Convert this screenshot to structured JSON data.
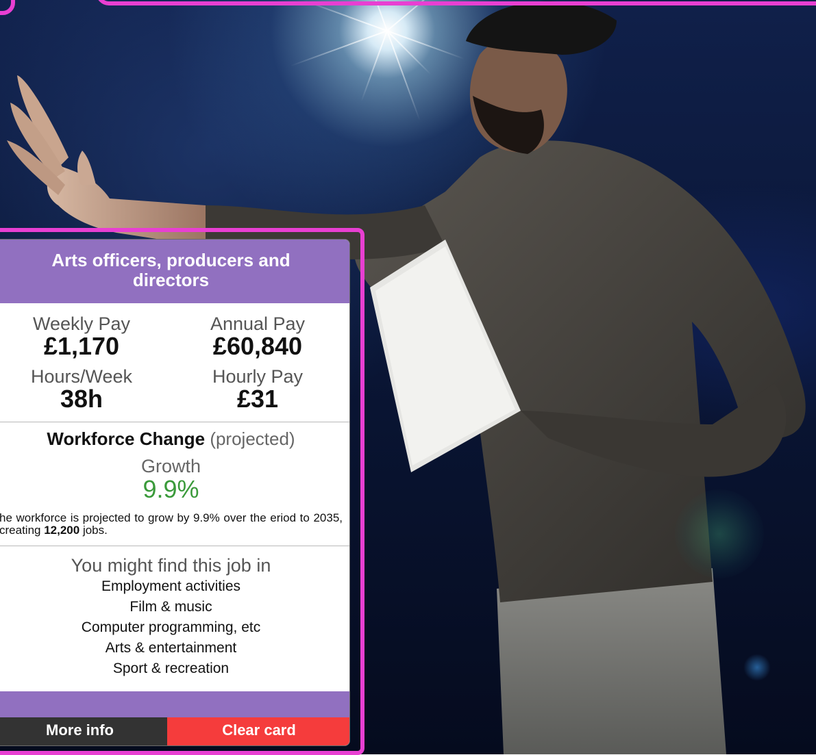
{
  "card": {
    "title": "Arts officers, producers and directors",
    "weekly_pay_label": "Weekly Pay",
    "weekly_pay_value": "£1,170",
    "annual_pay_label": "Annual Pay",
    "annual_pay_value": "£60,840",
    "hours_label": "Hours/Week",
    "hours_value": "38h",
    "hourly_pay_label": "Hourly Pay",
    "hourly_pay_value": "£31",
    "workforce_title": "Workforce Change",
    "workforce_qualifier": "(projected)",
    "growth_label": "Growth",
    "growth_value": "9.9%",
    "workforce_desc_prefix": "he workforce is projected to grow by 9.9% over the eriod to 2035, creating",
    "workforce_desc_jobs": "12,200",
    "workforce_desc_suffix": "jobs.",
    "sectors_title": "You might find this job in",
    "sectors": [
      "Employment activities",
      "Film &  music",
      "Computer programming, etc",
      "Arts & entertainment",
      "Sport & recreation"
    ],
    "more_info_label": "More info",
    "clear_card_label": "Clear card"
  },
  "colors": {
    "frame": "#e83fd2",
    "header": "#9170c0",
    "growth": "#3a9a3a",
    "more_info_bg": "#333333",
    "clear_card_bg": "#f53c3c"
  }
}
